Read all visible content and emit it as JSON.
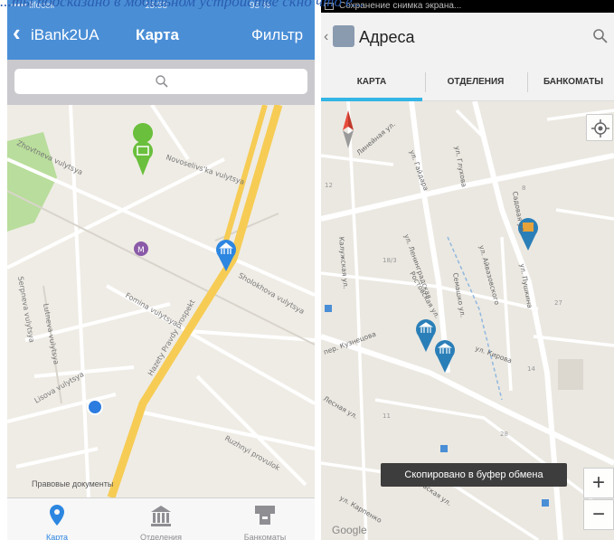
{
  "caption": "...ты подсказано в мобильном устройстве скно что е...",
  "ios": {
    "status": {
      "carrier": "••••• lifecell",
      "time": "15:53",
      "battery": "95 %"
    },
    "nav": {
      "back_label": "iBank2UA",
      "title": "Карта",
      "filter_label": "Фильтр"
    },
    "search": {
      "placeholder": ""
    },
    "map": {
      "street_labels": [
        "Novoselivs'ka vulytsya",
        "Zhovtneva vulytsya",
        "Fomina vulytsya",
        "Serpneva vulytsya",
        "Lisova vulytsya",
        "Lutneva vulytsya",
        "Hazety Pravdy prospekt",
        "Sholokhova vulytsya",
        "Ruzhnyi provulok"
      ],
      "legal": "Правовые документы",
      "colors": {
        "road_major": "#f6cc55",
        "park": "#b9dd9c",
        "atm_pin": "#6abf3c",
        "branch_pin": "#2d86e0",
        "metro": "#8a5aa8",
        "user_dot": "#2d7ce0"
      }
    },
    "tabs": [
      {
        "label": "Карта",
        "icon": "map-pin-icon",
        "active": true
      },
      {
        "label": "Отделения",
        "icon": "bank-building-icon",
        "active": false
      },
      {
        "label": "Банкоматы",
        "icon": "atm-icon",
        "active": false
      }
    ],
    "colors": {
      "accent": "#4a8ed6",
      "tab_active": "#2d86e0",
      "tab_inactive": "#8e8e93"
    }
  },
  "android": {
    "status": {
      "text": "Сохранение снимка экрана..."
    },
    "action_bar": {
      "title": "Адреса",
      "back_glyph": "‹"
    },
    "tabs": [
      {
        "label": "КАРТА",
        "active": true
      },
      {
        "label": "ОТДЕЛЕНИЯ",
        "active": false
      },
      {
        "label": "БАНКОМАТЫ",
        "active": false
      }
    ],
    "map": {
      "street_labels": [
        "Линейная ул.",
        "ул. Гайдара",
        "ул. Глухова",
        "ул. Ленинградская",
        "ул. Айвазовского",
        "Ростовская ул.",
        "Семашко ул.",
        "пер. Кузнецова",
        "Садовая ул.",
        "Калужская ул.",
        "ул. Кирова",
        "ул. Пушкина",
        "Обувская ул.",
        "ул. Карпенко",
        "Лесная ул."
      ],
      "numbers": [
        "12",
        "18/3",
        "8",
        "27",
        "14",
        "28",
        "11"
      ],
      "toast": "Скопировано в буфер обмена",
      "zoom_in": "+",
      "zoom_out": "−",
      "attribution": "Google",
      "colors": {
        "road": "#ffffff",
        "pin": "#2b7fb8",
        "pin_orange": "#e8a23a",
        "compass_red": "#c0392b"
      }
    }
  }
}
